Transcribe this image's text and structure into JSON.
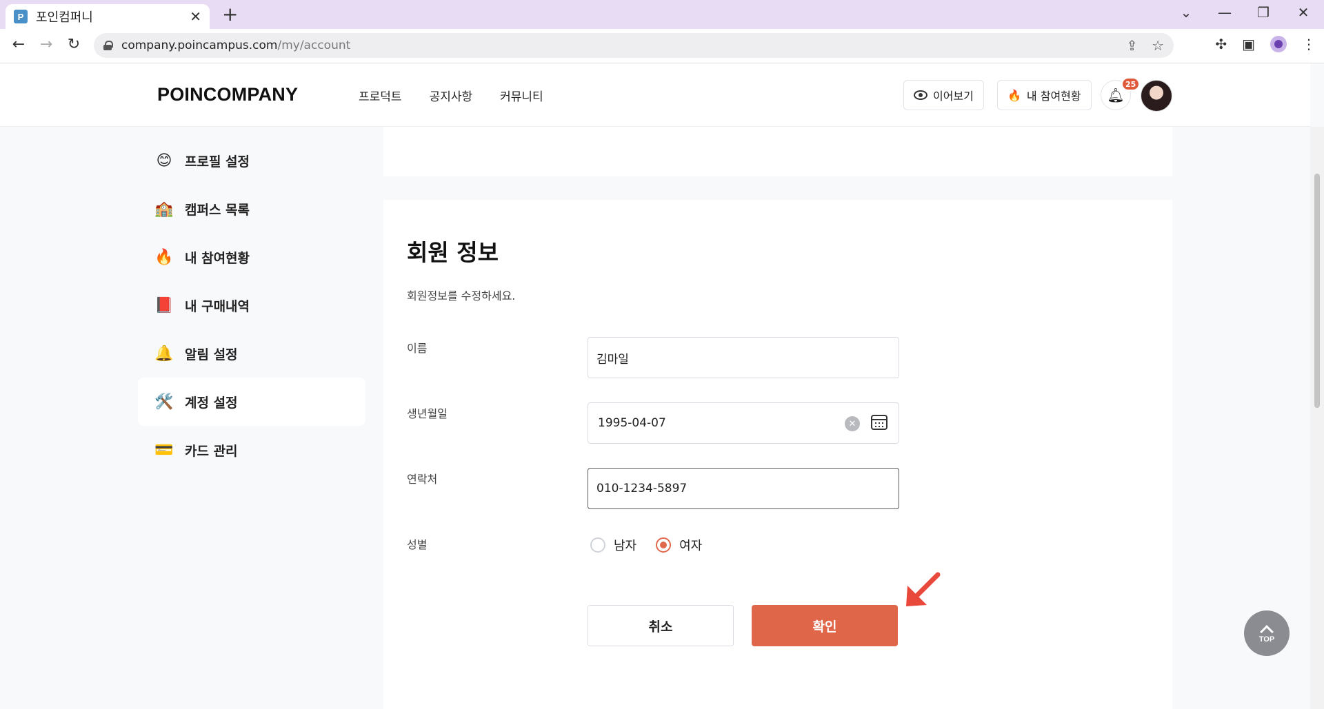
{
  "browser": {
    "tab_title": "포인컴퍼니",
    "tab_favicon_letter": "P",
    "url_host": "company.poincampus.com",
    "url_path": "/my/account"
  },
  "header": {
    "logo": "POINCOMPANY",
    "nav": [
      "프로덕트",
      "공지사항",
      "커뮤니티"
    ],
    "continue_watching": "이어보기",
    "my_participation": "내 참여현황",
    "notification_count": "25"
  },
  "sidebar": {
    "items": [
      {
        "icon": "😊",
        "label": "프로필 설정"
      },
      {
        "icon": "🏫",
        "label": "캠퍼스 목록"
      },
      {
        "icon": "🔥",
        "label": "내 참여현황"
      },
      {
        "icon": "📕",
        "label": "내 구매내역"
      },
      {
        "icon": "🔔",
        "label": "알림 설정"
      },
      {
        "icon": "🛠️",
        "label": "계정 설정"
      },
      {
        "icon": "💳",
        "label": "카드 관리"
      }
    ],
    "active_index": 5
  },
  "form": {
    "title": "회원 정보",
    "subtitle": "회원정보를 수정하세요.",
    "name_label": "이름",
    "name_value": "김마일",
    "birth_label": "생년월일",
    "birth_value": "1995-04-07",
    "phone_label": "연락처",
    "phone_value": "010-1234-5897",
    "gender_label": "성별",
    "gender_options": [
      "남자",
      "여자"
    ],
    "gender_selected": "여자",
    "cancel_label": "취소",
    "confirm_label": "확인"
  },
  "top_button": "TOP",
  "colors": {
    "accent": "#df6649",
    "tabbar": "#e8dcf4",
    "page_bg": "#f8f9fb"
  }
}
